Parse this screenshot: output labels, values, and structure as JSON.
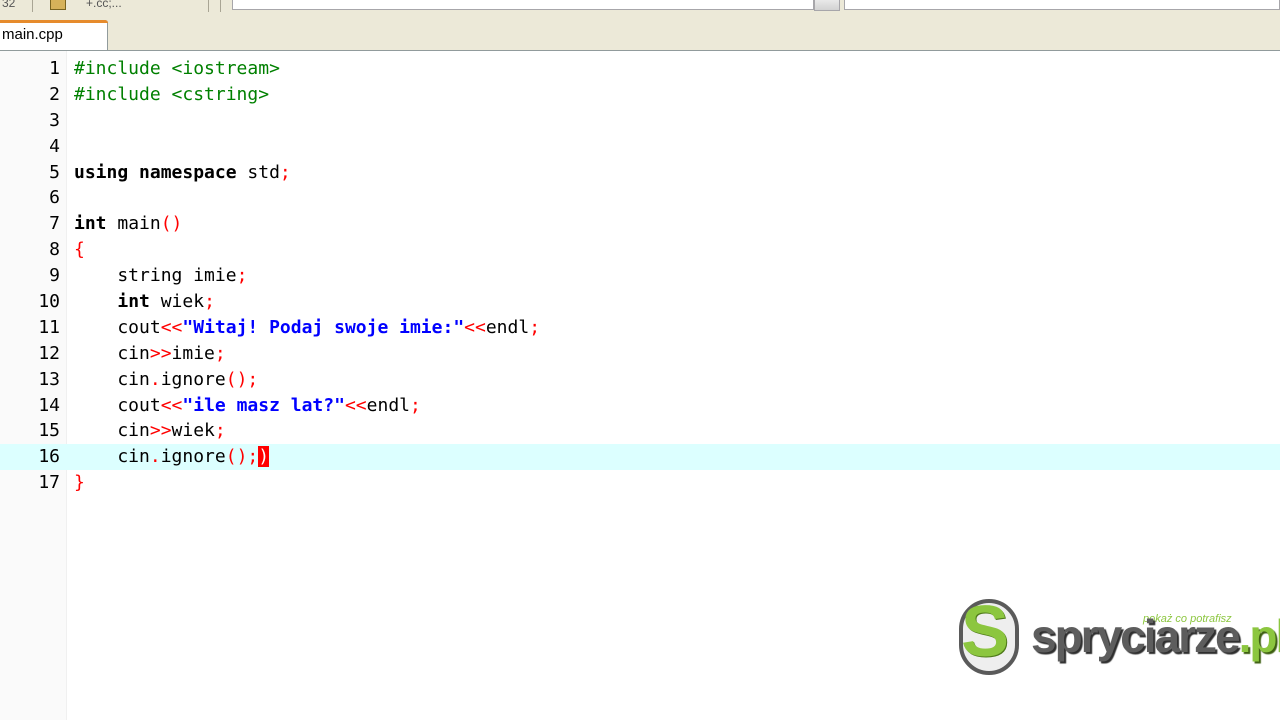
{
  "toolbar": {
    "left_fragment": "32",
    "fragment_2": "+.cc;..."
  },
  "tabs": [
    {
      "label": "main.cpp"
    }
  ],
  "editor": {
    "lines": [
      {
        "n": "1",
        "tokens": [
          {
            "t": "#include <iostream>",
            "c": "pp"
          }
        ]
      },
      {
        "n": "2",
        "tokens": [
          {
            "t": "#include <cstring>",
            "c": "pp"
          }
        ]
      },
      {
        "n": "3",
        "tokens": []
      },
      {
        "n": "4",
        "tokens": []
      },
      {
        "n": "5",
        "tokens": [
          {
            "t": "using namespace",
            "c": "kw"
          },
          {
            "t": " std"
          },
          {
            "t": ";",
            "c": "sym"
          }
        ]
      },
      {
        "n": "6",
        "tokens": []
      },
      {
        "n": "7",
        "tokens": [
          {
            "t": "int",
            "c": "kw"
          },
          {
            "t": " main"
          },
          {
            "t": "()",
            "c": "sym"
          }
        ]
      },
      {
        "n": "8",
        "tokens": [
          {
            "t": "{",
            "c": "sym"
          }
        ]
      },
      {
        "n": "9",
        "tokens": [
          {
            "t": "    string imie"
          },
          {
            "t": ";",
            "c": "sym"
          }
        ]
      },
      {
        "n": "10",
        "tokens": [
          {
            "t": "    "
          },
          {
            "t": "int",
            "c": "kw"
          },
          {
            "t": " wiek"
          },
          {
            "t": ";",
            "c": "sym"
          }
        ]
      },
      {
        "n": "11",
        "tokens": [
          {
            "t": "    cout"
          },
          {
            "t": "<<",
            "c": "sym"
          },
          {
            "t": "\"Witaj! Podaj swoje imie:\"",
            "c": "str"
          },
          {
            "t": "<<",
            "c": "sym"
          },
          {
            "t": "endl"
          },
          {
            "t": ";",
            "c": "sym"
          }
        ]
      },
      {
        "n": "12",
        "tokens": [
          {
            "t": "    cin"
          },
          {
            "t": ">>",
            "c": "sym"
          },
          {
            "t": "imie"
          },
          {
            "t": ";",
            "c": "sym"
          }
        ]
      },
      {
        "n": "13",
        "tokens": [
          {
            "t": "    cin"
          },
          {
            "t": ".",
            "c": "sym"
          },
          {
            "t": "ignore"
          },
          {
            "t": "()",
            "c": "sym"
          },
          {
            "t": ";",
            "c": "sym"
          }
        ]
      },
      {
        "n": "14",
        "tokens": [
          {
            "t": "    cout"
          },
          {
            "t": "<<",
            "c": "sym"
          },
          {
            "t": "\"ile masz lat?\"",
            "c": "str"
          },
          {
            "t": "<<",
            "c": "sym"
          },
          {
            "t": "endl"
          },
          {
            "t": ";",
            "c": "sym"
          }
        ]
      },
      {
        "n": "15",
        "tokens": [
          {
            "t": "    cin"
          },
          {
            "t": ">>",
            "c": "sym"
          },
          {
            "t": "wiek"
          },
          {
            "t": ";",
            "c": "sym"
          }
        ]
      },
      {
        "n": "16",
        "current": true,
        "tokens": [
          {
            "t": "    cin"
          },
          {
            "t": ".",
            "c": "sym"
          },
          {
            "t": "ignore"
          },
          {
            "t": "()",
            "c": "sym"
          },
          {
            "t": ";",
            "c": "sym"
          },
          {
            "t": ")",
            "c": "caret-hl"
          }
        ]
      },
      {
        "n": "17",
        "tokens": [
          {
            "t": "}",
            "c": "sym"
          }
        ]
      }
    ]
  },
  "watermark": {
    "brand": "spryciarze",
    "tld": ".pl",
    "tagline": "pokaż co potrafisz"
  },
  "colors": {
    "preprocessor": "#008000",
    "string": "#0000ff",
    "symbol": "#ff0000",
    "current_line": "#dcffff",
    "brand_green": "#8cc63f"
  }
}
